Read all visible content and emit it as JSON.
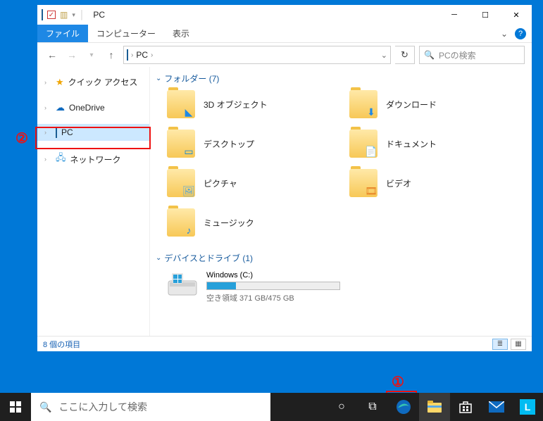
{
  "window": {
    "title": "PC",
    "tabs": {
      "file": "ファイル",
      "computer": "コンピューター",
      "view": "表示"
    }
  },
  "address": {
    "crumb": "PC",
    "search_placeholder": "PCの検索"
  },
  "nav": {
    "quick": "クイック アクセス",
    "onedrive": "OneDrive",
    "pc": "PC",
    "network": "ネットワーク"
  },
  "groups": {
    "folders_header": "フォルダー (7)",
    "drives_header": "デバイスとドライブ (1)"
  },
  "folders": [
    {
      "label": "3D オブジェクト",
      "overlay_color": "#1e88e5",
      "overlay_glyph": "◣"
    },
    {
      "label": "ダウンロード",
      "overlay_color": "#1e88e5",
      "overlay_glyph": "⬇"
    },
    {
      "label": "デスクトップ",
      "overlay_color": "#0a84d6",
      "overlay_glyph": "▭"
    },
    {
      "label": "ドキュメント",
      "overlay_color": "#2f78c5",
      "overlay_glyph": "📄"
    },
    {
      "label": "ピクチャ",
      "overlay_color": "#4aa3df",
      "overlay_glyph": "🖼"
    },
    {
      "label": "ビデオ",
      "overlay_color": "#e67e22",
      "overlay_glyph": "🎞"
    },
    {
      "label": "ミュージック",
      "overlay_color": "#1e88e5",
      "overlay_glyph": "♪"
    }
  ],
  "drive": {
    "name": "Windows (C:)",
    "free_text": "空き領域 371 GB/475 GB",
    "fill_pct": 22
  },
  "status": {
    "text": "8 個の項目"
  },
  "annotations": {
    "one": "①",
    "two": "②"
  },
  "taskbar": {
    "search_placeholder": "ここに入力して検索"
  }
}
